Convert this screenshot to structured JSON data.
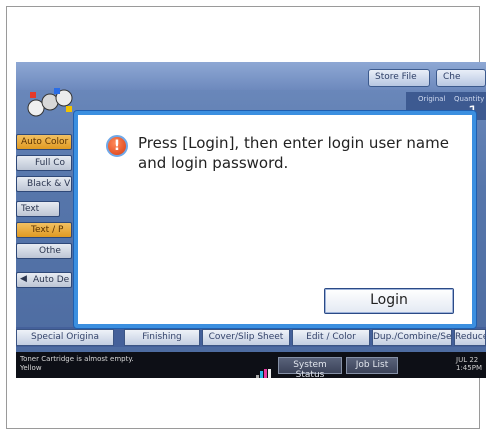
{
  "top_buttons": {
    "store_file": "Store File",
    "quantity_partial": "Che"
  },
  "info_bar": {
    "original": "Original",
    "quantity": "Quantity",
    "count_partial": "1"
  },
  "side_buttons": {
    "auto_color": "Auto Color",
    "full_color": "Full Co",
    "black_white": "Black & V",
    "text": "Text",
    "text_photo": "Text / P",
    "other": "Othe",
    "auto_density": "Auto De"
  },
  "tabs": {
    "special_original": "Special Origina",
    "finishing": "Finishing",
    "cover_slip": "Cover/Slip Sheet",
    "edit_color": "Edit / Color",
    "dup_combine": "Dup./Combine/Series",
    "reduce": "Reduce"
  },
  "status": {
    "warning_line1": "Toner Cartridge is almost empty.",
    "warning_line2": "Yellow",
    "system_status": "System Status",
    "job_list": "Job List",
    "date": "JUL   22",
    "time": "1:45PM"
  },
  "dialog": {
    "message": "Press [Login], then enter login user name and login password.",
    "login_button": "Login"
  },
  "colors": {
    "dialog_border": "#3b8fe0",
    "accent_orange": "#e09a22",
    "screen_blue": "#5676ab"
  }
}
